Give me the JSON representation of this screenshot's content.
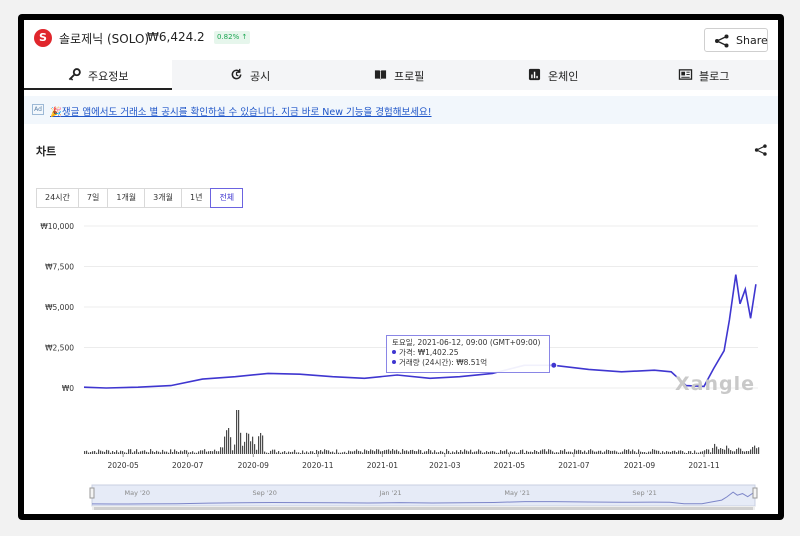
{
  "header": {
    "logo_letter": "S",
    "coin_name": "솔로제닉 (SOLO)",
    "price": "₩6,424.2",
    "change": "0.82% ↑",
    "share_label": "Share"
  },
  "tabs": [
    {
      "label": "주요정보",
      "icon": "key-icon",
      "active": true
    },
    {
      "label": "공시",
      "icon": "refresh-icon",
      "active": false
    },
    {
      "label": "프로필",
      "icon": "book-icon",
      "active": false
    },
    {
      "label": "온체인",
      "icon": "bar-chart-icon",
      "active": false
    },
    {
      "label": "블로그",
      "icon": "newspaper-icon",
      "active": false
    }
  ],
  "ad": {
    "tag": "Ad",
    "text": "🎉쟁글 앱에서도 거래소 별 공시를 확인하실 수 있습니다. 지금 바로 New 기능을 경험해보세요!"
  },
  "chart_section": {
    "title": "차트",
    "ranges": [
      "24시간",
      "7일",
      "1개월",
      "3개월",
      "1년",
      "전체"
    ],
    "active_range": "전체",
    "tooltip": {
      "date": "토요일, 2021-06-12, 09:00 (GMT+09:00)",
      "price": "가격: ₩1,402.25",
      "volume": "거래량 (24시간): ₩8.51억"
    },
    "watermark": "Xangle",
    "colors": {
      "line": "#3f36d0",
      "accent": "#1aa551",
      "logo": "#e0262c"
    }
  },
  "chart_data": {
    "type": "line",
    "title": "",
    "ylabel": "",
    "ylim": [
      0,
      10000
    ],
    "y_ticks": [
      "₩10,000",
      "₩7,500",
      "₩5,000",
      "₩2,500",
      "₩0"
    ],
    "x_ticks": [
      "2020-05",
      "2020-07",
      "2020-09",
      "2020-11",
      "2021-01",
      "2021-03",
      "2021-05",
      "2021-07",
      "2021-09",
      "2021-11"
    ],
    "navigator_labels": [
      "May '20",
      "Sep '20",
      "Jan '21",
      "May '21",
      "Sep '21"
    ],
    "series": [
      {
        "x": [
          "2020-03-25",
          "2020-04-15",
          "2020-05-15",
          "2020-06-15",
          "2020-07-15",
          "2020-08-15",
          "2020-09-15",
          "2020-10-15",
          "2020-11-15",
          "2020-12-15",
          "2021-01-15",
          "2021-02-15",
          "2021-03-15",
          "2021-04-15",
          "2021-05-15",
          "2021-06-12",
          "2021-07-15",
          "2021-08-15",
          "2021-09-15",
          "2021-10-01",
          "2021-10-15",
          "2021-11-01",
          "2021-11-10",
          "2021-11-20",
          "2021-11-25",
          "2021-12-01",
          "2021-12-05",
          "2021-12-10",
          "2021-12-15",
          "2021-12-20"
        ],
        "values": [
          50,
          0,
          50,
          150,
          550,
          700,
          900,
          850,
          700,
          600,
          800,
          600,
          700,
          900,
          1400,
          1402.25,
          1150,
          1000,
          1100,
          1000,
          150,
          100,
          1200,
          2300,
          4200,
          7000,
          5200,
          6100,
          4300,
          6400
        ]
      }
    ],
    "volume_note": "daily volume bars below main series (peak around 2020-08)"
  }
}
